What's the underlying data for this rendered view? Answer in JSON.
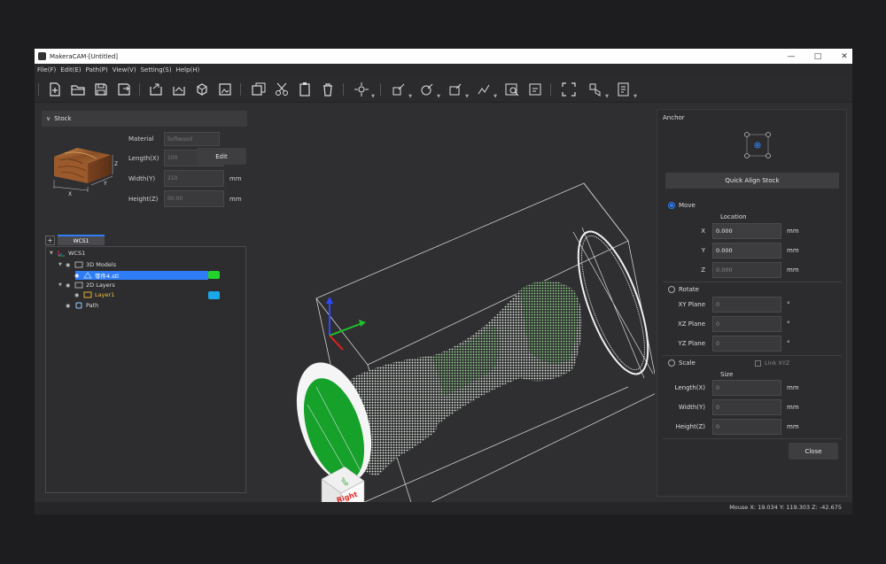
{
  "window": {
    "title": "MakeraCAM-[Untitled]"
  },
  "menu": [
    "File(F)",
    "Edit(E)",
    "Path(P)",
    "View(V)",
    "Setting(S)",
    "Help(H)"
  ],
  "stock": {
    "header": "Stock",
    "material_label": "Material",
    "material_value": "Softwood",
    "length_label": "Length(X)",
    "length_value": "100",
    "width_label": "Width(Y)",
    "width_value": "210",
    "height_label": "Height(Z)",
    "height_value": "00.00",
    "unit": "mm",
    "edit_label": "Edit",
    "cube_labels": {
      "x": "X",
      "y": "Y",
      "z": "Z"
    }
  },
  "tree": {
    "tab_label": "WCS1",
    "root": "WCS1",
    "models_group": "3D Models",
    "model_item": "零件4.stl",
    "layers_group": "2D Layers",
    "layer_item": "Layer1",
    "path_item": "Path",
    "model_color": "#21d32b",
    "layer_color": "#1aa8ea"
  },
  "viewcube": {
    "face_label": "Right"
  },
  "anchor": {
    "title": "Anchor",
    "quick_align_label": "Quick Align Stock",
    "move_label": "Move",
    "location_label": "Location",
    "x_label": "X",
    "x_value": "0.000",
    "y_label": "Y",
    "y_value": "0.000",
    "z_label": "Z",
    "z_value": "0.000",
    "rotate_label": "Rotate",
    "xy_label": "XY Plane",
    "xy_value": "0",
    "xz_label": "XZ Plane",
    "xz_value": "0",
    "yz_label": "YZ Plane",
    "yz_value": "0",
    "deg": "°",
    "scale_label": "Scale",
    "link_label": "Link XYZ",
    "size_label": "Size",
    "lx_label": "Length(X)",
    "lx_value": "0",
    "wy_label": "Width(Y)",
    "wy_value": "0",
    "hz_label": "Height(Z)",
    "hz_value": "0",
    "unit": "mm",
    "close_label": "Close"
  },
  "status": {
    "mouse": "Mouse X: 19.034 Y: 119.303 Z: -42.675"
  },
  "accent": "#2f7df6"
}
